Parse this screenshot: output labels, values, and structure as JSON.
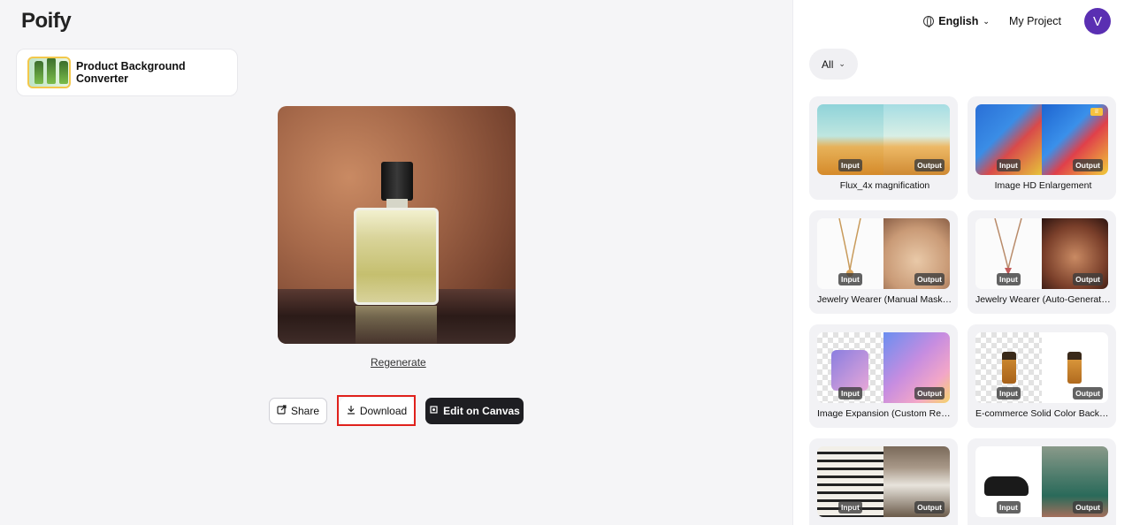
{
  "brand": {
    "logo": "Poify"
  },
  "tool": {
    "title": "Product Background Converter"
  },
  "result": {
    "regenerate_label": "Regenerate"
  },
  "actions": {
    "share_label": "Share",
    "download_label": "Download",
    "edit_label": "Edit on Canvas"
  },
  "header": {
    "language": "English",
    "my_project": "My Project",
    "avatar_initial": "V"
  },
  "filter": {
    "selected": "All"
  },
  "tag_input": "Input",
  "tag_output": "Output",
  "templates": [
    {
      "label": "Flux_4x magnification"
    },
    {
      "label": "Image HD Enlargement"
    },
    {
      "label": "Jewelry Wearer (Manual Mask ..."
    },
    {
      "label": "Jewelry Wearer (Auto-Generate..."
    },
    {
      "label": "Image Expansion (Custom Reso..."
    },
    {
      "label": "E-commerce Solid Color Backgr..."
    },
    {
      "label": ""
    },
    {
      "label": ""
    }
  ],
  "colors": {
    "accent": "#5a2fb2",
    "highlight": "#e0211c",
    "dark_button": "#1e1e22"
  }
}
